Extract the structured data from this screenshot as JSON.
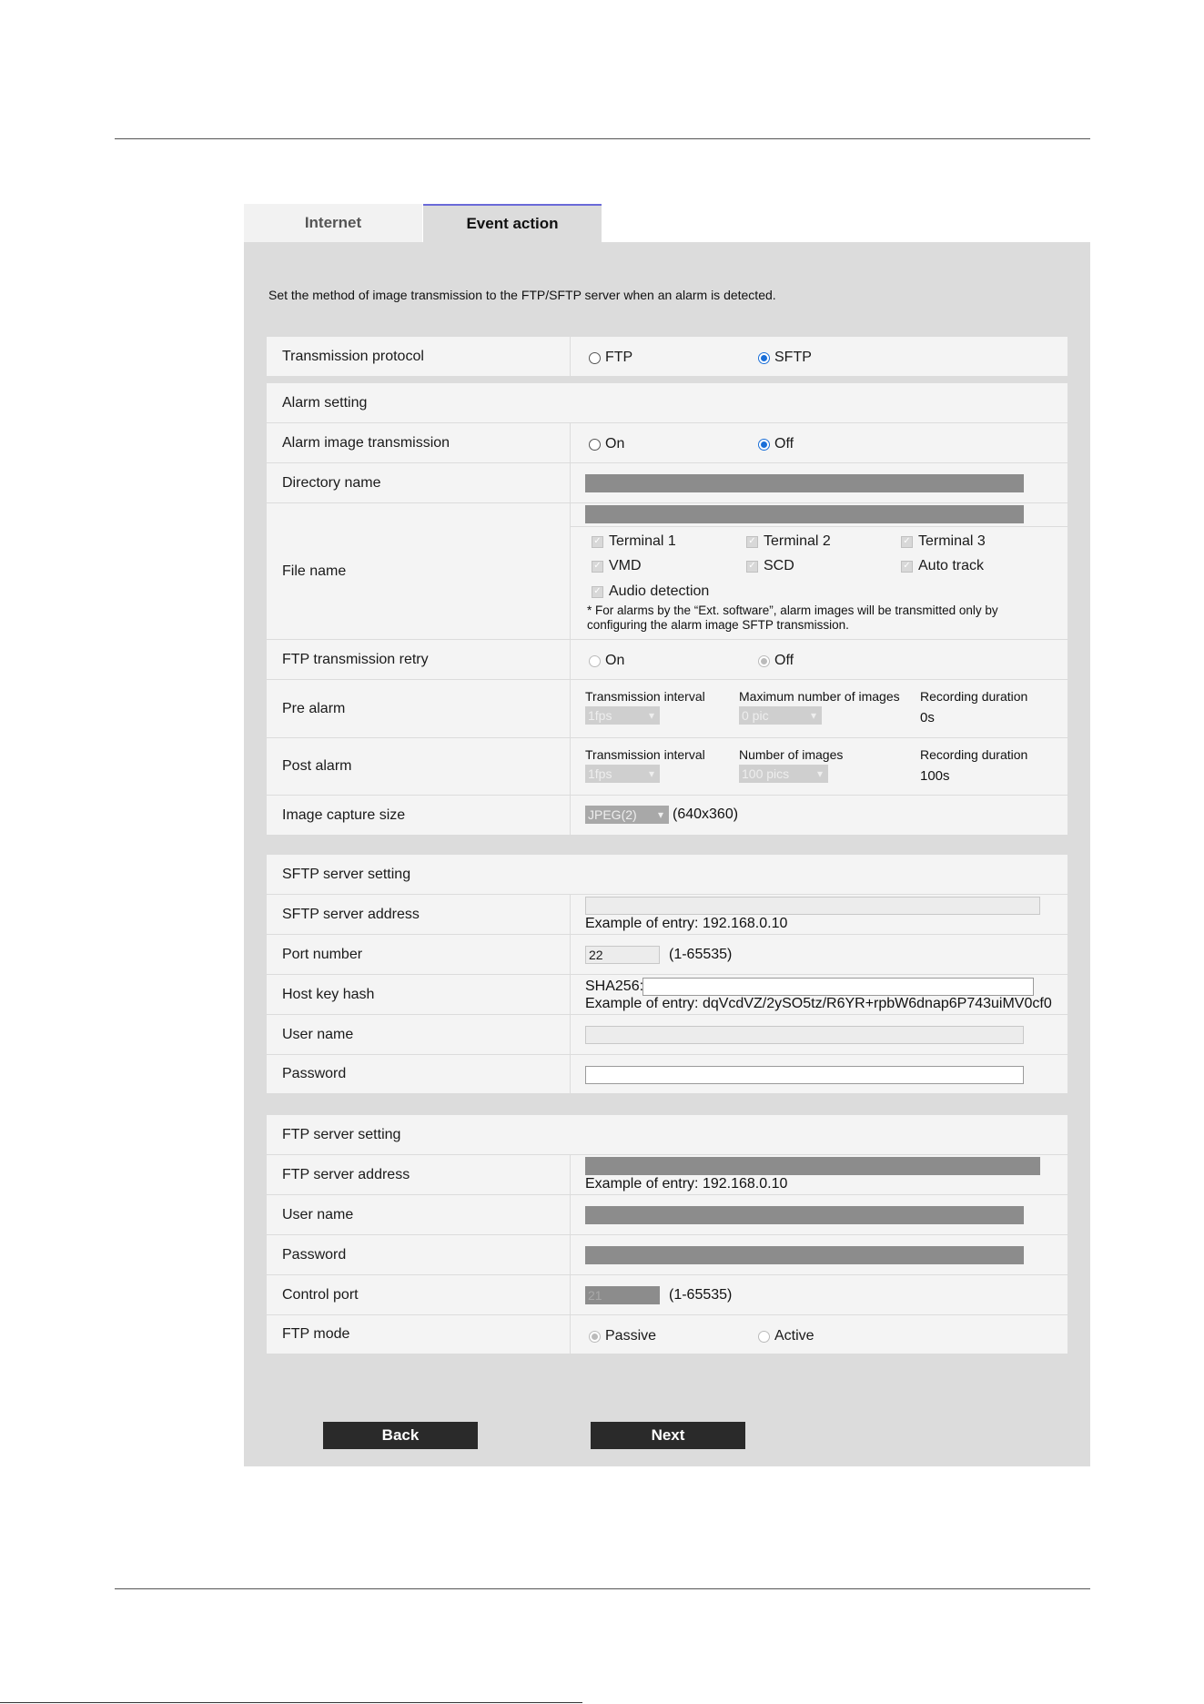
{
  "tabs": {
    "internet": "Internet",
    "event_action": "Event action"
  },
  "intro": "Set the method of image transmission to the FTP/SFTP server when an alarm is detected.",
  "transmission_protocol": {
    "label": "Transmission protocol",
    "ftp": "FTP",
    "sftp": "SFTP",
    "selected": "SFTP"
  },
  "alarm": {
    "header": "Alarm setting",
    "image_transmission": {
      "label": "Alarm image transmission",
      "on": "On",
      "off": "Off",
      "selected": "Off"
    },
    "directory_name": {
      "label": "Directory name"
    },
    "file_name": {
      "label": "File name",
      "checks": [
        "Terminal 1",
        "Terminal 2",
        "Terminal 3",
        "VMD",
        "SCD",
        "Auto track",
        "Audio detection"
      ],
      "note": "* For alarms by the “Ext. software”, alarm images will be transmitted only by configuring the alarm image SFTP transmission."
    },
    "ftp_retry": {
      "label": "FTP transmission retry",
      "on": "On",
      "off": "Off",
      "selected": "Off"
    },
    "pre_alarm": {
      "label": "Pre alarm",
      "interval_label": "Transmission interval",
      "interval_value": "1fps",
      "max_label": "Maximum number of images",
      "max_value": "0 pic",
      "duration_label": "Recording duration",
      "duration_value": "0s"
    },
    "post_alarm": {
      "label": "Post alarm",
      "interval_label": "Transmission interval",
      "interval_value": "1fps",
      "num_label": "Number of images",
      "num_value": "100 pics",
      "duration_label": "Recording duration",
      "duration_value": "100s"
    },
    "capture_size": {
      "label": "Image capture size",
      "value": "JPEG(2)",
      "resolution": "(640x360)"
    }
  },
  "sftp": {
    "header": "SFTP server setting",
    "address": {
      "label": "SFTP server address",
      "example": "Example of entry: 192.168.0.10"
    },
    "port": {
      "label": "Port number",
      "value": "22",
      "range": "(1-65535)"
    },
    "host_key": {
      "label": "Host key hash",
      "prefix": "SHA256:",
      "example": "Example of entry: dqVcdVZ/2ySO5tz/R6YR+rpbW6dnap6P743uiMV0cf0"
    },
    "user": {
      "label": "User name"
    },
    "password": {
      "label": "Password"
    }
  },
  "ftp": {
    "header": "FTP server setting",
    "address": {
      "label": "FTP server address",
      "example": "Example of entry: 192.168.0.10"
    },
    "user": {
      "label": "User name"
    },
    "password": {
      "label": "Password"
    },
    "control_port": {
      "label": "Control port",
      "value": "21",
      "range": "(1-65535)"
    },
    "mode": {
      "label": "FTP mode",
      "passive": "Passive",
      "active": "Active",
      "selected": "Passive"
    }
  },
  "buttons": {
    "back": "Back",
    "next": "Next"
  }
}
